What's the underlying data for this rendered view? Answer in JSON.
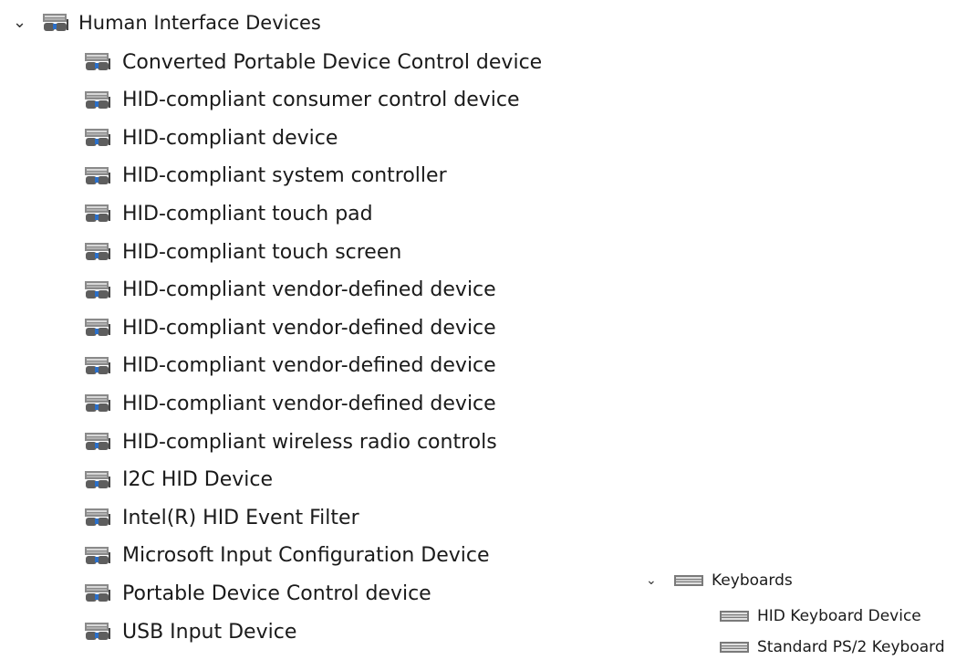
{
  "hid": {
    "category_label": "Human Interface Devices",
    "expanded_glyph": "⌄",
    "icon": "hid-device-icon",
    "children": [
      "Converted Portable Device Control device",
      "HID-compliant consumer control device",
      "HID-compliant device",
      "HID-compliant system controller",
      "HID-compliant touch pad",
      "HID-compliant touch screen",
      "HID-compliant vendor-defined device",
      "HID-compliant vendor-defined device",
      "HID-compliant vendor-defined device",
      "HID-compliant vendor-defined device",
      "HID-compliant wireless radio controls",
      "I2C HID Device",
      "Intel(R) HID Event Filter",
      "Microsoft Input Configuration Device",
      "Portable Device Control device",
      "USB Input Device"
    ]
  },
  "keyboards": {
    "category_label": "Keyboards",
    "expanded_glyph": "⌄",
    "icon": "keyboard-icon",
    "children": [
      "HID Keyboard Device",
      "Standard PS/2 Keyboard"
    ]
  },
  "colors": {
    "text": "#1a1a1a",
    "icon_gray": "#6b6b6b",
    "icon_blue": "#2a6fc9"
  }
}
